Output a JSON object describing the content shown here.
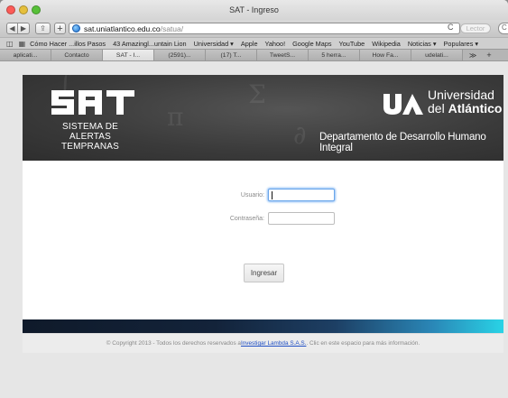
{
  "window": {
    "title": "SAT - Ingreso"
  },
  "toolbar": {
    "back_label": "◀",
    "forward_label": "▶",
    "share_label": "⇪",
    "add_label": "+",
    "url_host": "sat.uniatlantico.edu.co",
    "url_path": "/satua/",
    "reload_label": "C",
    "reader_label": "Lector",
    "search_label": "C"
  },
  "bookmarks": {
    "book_icon": "book-icon",
    "grid_icon": "grid-icon",
    "items": [
      "Cómo Hacer ...illos Pasos",
      "43 Amazingl...untain Lion",
      "Universidad ▾",
      "Apple",
      "Yahoo!",
      "Google Maps",
      "YouTube",
      "Wikipedia",
      "Noticias ▾",
      "Populares ▾"
    ]
  },
  "tabs": {
    "items": [
      "aplicati...",
      "Contacto",
      "SAT - I...",
      "(2591)...",
      "(17) T...",
      "TweetS...",
      "5 herra...",
      "How Fa...",
      "udelati..."
    ],
    "active_index": 2,
    "overflow_label": "≫",
    "add_label": "+"
  },
  "banner": {
    "sat_sub_line1": "SISTEMA DE ALERTAS",
    "sat_sub_line2": "TEMPRANAS",
    "ua_universidad": "Universidad",
    "ua_del": "del",
    "ua_atlantico": "Atlántico",
    "department": "Departamento de Desarrollo Humano Integral"
  },
  "login": {
    "usuario_label": "Usuario:",
    "usuario_value": "",
    "password_label": "Contraseña:",
    "password_value": "",
    "submit_label": "Ingresar"
  },
  "footer": {
    "text_before": "© Copyright 2013 - Todos los derechos reservados a ",
    "link_text": "Investigar Lambda S.A.S.",
    "text_after": ". Clic en este espacio para más información."
  },
  "colors": {
    "banner_bg": "#3a3a3a",
    "bar_start": "#0f1a2a",
    "bar_end": "#29d3e6",
    "link": "#1f4fc4"
  }
}
